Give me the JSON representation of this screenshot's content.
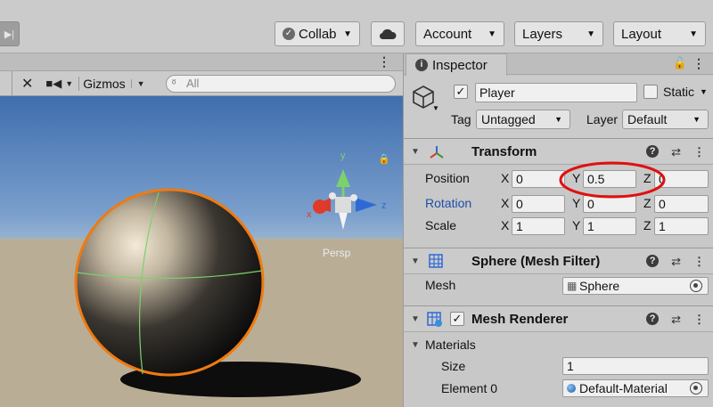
{
  "toolbar": {
    "collab_label": "Collab",
    "account_label": "Account",
    "layers_label": "Layers",
    "layout_label": "Layout"
  },
  "scene": {
    "gizmos_label": "Gizmos",
    "search_placeholder": "All",
    "gizmo_axes": {
      "x": "x",
      "y": "y",
      "z": "z"
    },
    "persp_label": "Persp"
  },
  "inspector": {
    "tab_label": "Inspector",
    "object_name": "Player",
    "active": true,
    "static_label": "Static",
    "tag_label": "Tag",
    "tag_value": "Untagged",
    "layer_label": "Layer",
    "layer_value": "Default",
    "transform": {
      "title": "Transform",
      "position_label": "Position",
      "rotation_label": "Rotation",
      "scale_label": "Scale",
      "axis_x": "X",
      "axis_y": "Y",
      "axis_z": "Z",
      "position": {
        "x": "0",
        "y": "0.5",
        "z": "0"
      },
      "rotation": {
        "x": "0",
        "y": "0",
        "z": "0"
      },
      "scale": {
        "x": "1",
        "y": "1",
        "z": "1"
      }
    },
    "mesh_filter": {
      "title": "Sphere (Mesh Filter)",
      "mesh_label": "Mesh",
      "mesh_value": "Sphere"
    },
    "mesh_renderer": {
      "title": "Mesh Renderer",
      "enabled": true,
      "materials_label": "Materials",
      "size_label": "Size",
      "size_value": "1",
      "element0_label": "Element 0",
      "element0_value": "Default-Material"
    }
  },
  "colors": {
    "highlight_circle": "#e01010",
    "selection_outline": "#f07a10",
    "rotation_label": "#1f4fa6"
  }
}
